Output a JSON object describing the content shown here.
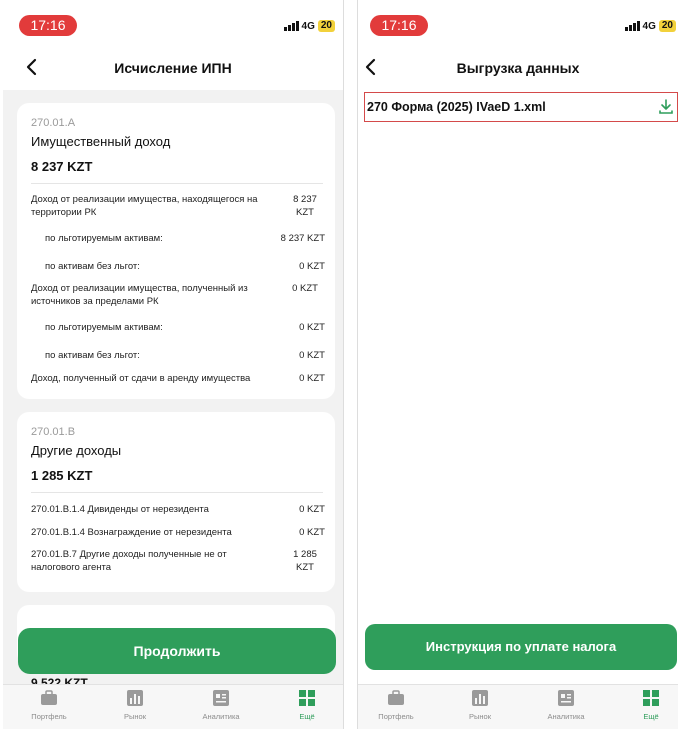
{
  "screen1": {
    "status": {
      "time": "17:16",
      "network": "4G",
      "battery": "20"
    },
    "title": "Исчисление ИПН",
    "cards": [
      {
        "code": "270.01.A",
        "title": "Имущественный доход",
        "amount": "8 237 KZT",
        "rows": [
          {
            "label": "Доход от реализации имущества, находящегося на территории РК",
            "value": "8 237 KZT"
          },
          {
            "label": "по льготируемым активам:",
            "value": "8 237 KZT"
          },
          {
            "label": "по активам без льгот:",
            "value": "0 KZT"
          },
          {
            "label": "Доход от реализации имущества, полученный из источников за пределами РК",
            "value": "0 KZT"
          },
          {
            "label": "по льготируемым активам:",
            "value": "0 KZT"
          },
          {
            "label": "по активам без льгот:",
            "value": "0 KZT"
          },
          {
            "label": "Доход, полученный от сдачи в аренду имущества",
            "value": "0 KZT"
          }
        ]
      },
      {
        "code": "270.01.B",
        "title": "Другие доходы",
        "amount": "1 285 KZT",
        "rows": [
          {
            "label": "270.01.B.1.4 Дивиденды от нерезидента",
            "value": "0 KZT"
          },
          {
            "label": "270.01.B.1.4 Вознаграждение от нерезидента",
            "value": "0 KZT"
          },
          {
            "label": "270.01.B.7 Другие доходы полученные не от налогового агента",
            "value": "1 285 KZT"
          }
        ]
      }
    ],
    "peek_amount": "9 522 KZT",
    "continue_label": "Продолжить"
  },
  "screen2": {
    "status": {
      "time": "17:16",
      "network": "4G",
      "battery": "20"
    },
    "title": "Выгрузка данных",
    "file_name": "270 Форма (2025) IVaeD 1.xml",
    "instruction_label": "Инструкция по уплате налога"
  },
  "tabs": [
    "Портфель",
    "Рынок",
    "Аналитика",
    "Ещё"
  ],
  "colors": {
    "accent": "#2f9e5b",
    "status_pill": "#e23b3b",
    "battery": "#f2d13b"
  }
}
